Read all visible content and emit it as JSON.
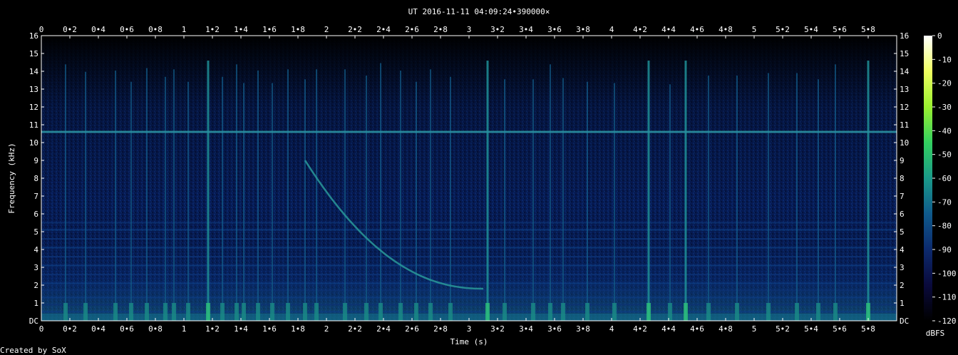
{
  "chart_data": {
    "type": "heatmap",
    "title": "UT 2016-11-11 04:09:24•390000×",
    "xlabel": "Time (s)",
    "ylabel": "Frequency (kHz)",
    "x_ticks": [
      "0",
      "0•2",
      "0•4",
      "0•6",
      "0•8",
      "1",
      "1•2",
      "1•4",
      "1•6",
      "1•8",
      "2",
      "2•2",
      "2•4",
      "2•6",
      "2•8",
      "3",
      "3•2",
      "3•4",
      "3•6",
      "3•8",
      "4",
      "4•2",
      "4•4",
      "4•6",
      "4•8",
      "5",
      "5•2",
      "5•4",
      "5•6",
      "5•8"
    ],
    "y_ticks": [
      "DC",
      "1",
      "2",
      "3",
      "4",
      "5",
      "6",
      "7",
      "8",
      "9",
      "10",
      "11",
      "12",
      "13",
      "14",
      "15",
      "16"
    ],
    "xlim": [
      0,
      5.96
    ],
    "ylim": [
      0,
      16
    ],
    "colorbar_label": "dBFS",
    "colorbar_ticks": [
      "0",
      "-10",
      "-20",
      "-30",
      "-40",
      "-50",
      "-60",
      "-70",
      "-80",
      "-90",
      "-100",
      "-110",
      "-120"
    ],
    "colorbar_range": [
      -120,
      0
    ],
    "colormap": [
      "#000000",
      "#0a0a3c",
      "#0c2a6e",
      "#0f5a8c",
      "#1a9a8a",
      "#33d060",
      "#9af030",
      "#f0ff60",
      "#ffffff"
    ],
    "features": {
      "horizontal_tone_khz": 10.6,
      "strong_transients_s": [
        1.17,
        3.13,
        4.26,
        4.52,
        5.8
      ],
      "vertical_lines_s": [
        0.17,
        0.31,
        0.52,
        0.63,
        0.74,
        0.87,
        0.93,
        1.03,
        1.17,
        1.27,
        1.37,
        1.42,
        1.52,
        1.62,
        1.73,
        1.85,
        1.93,
        2.13,
        2.28,
        2.38,
        2.52,
        2.63,
        2.73,
        2.87,
        3.13,
        3.25,
        3.45,
        3.57,
        3.66,
        3.83,
        4.02,
        4.26,
        4.41,
        4.52,
        4.68,
        4.88,
        5.1,
        5.3,
        5.45,
        5.57,
        5.8
      ],
      "chirp": {
        "t_start": 1.85,
        "f_start_khz": 9.0,
        "t_end": 3.1,
        "f_end_khz": 1.8
      }
    },
    "footer": "Created by SoX"
  }
}
